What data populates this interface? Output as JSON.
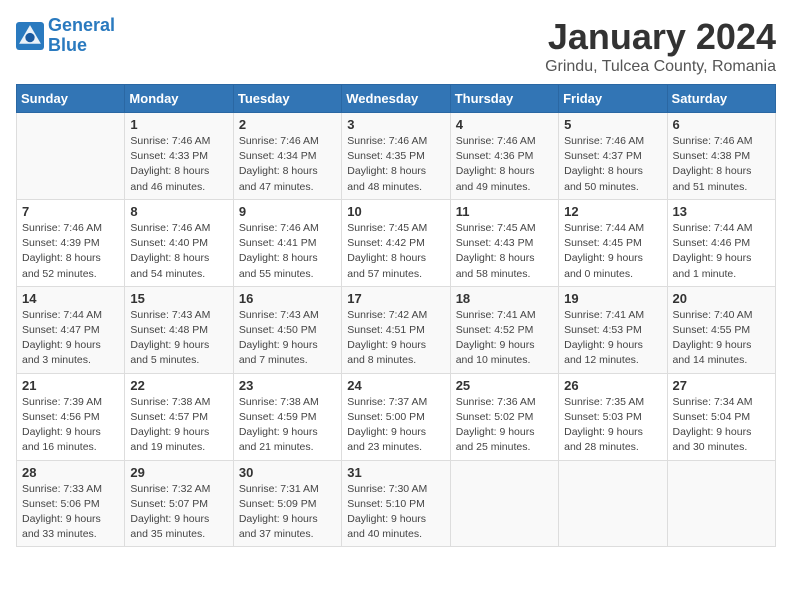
{
  "logo": {
    "line1": "General",
    "line2": "Blue"
  },
  "title": "January 2024",
  "location": "Grindu, Tulcea County, Romania",
  "weekdays": [
    "Sunday",
    "Monday",
    "Tuesday",
    "Wednesday",
    "Thursday",
    "Friday",
    "Saturday"
  ],
  "weeks": [
    [
      {
        "day": "",
        "sunrise": "",
        "sunset": "",
        "daylight": ""
      },
      {
        "day": "1",
        "sunrise": "Sunrise: 7:46 AM",
        "sunset": "Sunset: 4:33 PM",
        "daylight": "Daylight: 8 hours and 46 minutes."
      },
      {
        "day": "2",
        "sunrise": "Sunrise: 7:46 AM",
        "sunset": "Sunset: 4:34 PM",
        "daylight": "Daylight: 8 hours and 47 minutes."
      },
      {
        "day": "3",
        "sunrise": "Sunrise: 7:46 AM",
        "sunset": "Sunset: 4:35 PM",
        "daylight": "Daylight: 8 hours and 48 minutes."
      },
      {
        "day": "4",
        "sunrise": "Sunrise: 7:46 AM",
        "sunset": "Sunset: 4:36 PM",
        "daylight": "Daylight: 8 hours and 49 minutes."
      },
      {
        "day": "5",
        "sunrise": "Sunrise: 7:46 AM",
        "sunset": "Sunset: 4:37 PM",
        "daylight": "Daylight: 8 hours and 50 minutes."
      },
      {
        "day": "6",
        "sunrise": "Sunrise: 7:46 AM",
        "sunset": "Sunset: 4:38 PM",
        "daylight": "Daylight: 8 hours and 51 minutes."
      }
    ],
    [
      {
        "day": "7",
        "sunrise": "Sunrise: 7:46 AM",
        "sunset": "Sunset: 4:39 PM",
        "daylight": "Daylight: 8 hours and 52 minutes."
      },
      {
        "day": "8",
        "sunrise": "Sunrise: 7:46 AM",
        "sunset": "Sunset: 4:40 PM",
        "daylight": "Daylight: 8 hours and 54 minutes."
      },
      {
        "day": "9",
        "sunrise": "Sunrise: 7:46 AM",
        "sunset": "Sunset: 4:41 PM",
        "daylight": "Daylight: 8 hours and 55 minutes."
      },
      {
        "day": "10",
        "sunrise": "Sunrise: 7:45 AM",
        "sunset": "Sunset: 4:42 PM",
        "daylight": "Daylight: 8 hours and 57 minutes."
      },
      {
        "day": "11",
        "sunrise": "Sunrise: 7:45 AM",
        "sunset": "Sunset: 4:43 PM",
        "daylight": "Daylight: 8 hours and 58 minutes."
      },
      {
        "day": "12",
        "sunrise": "Sunrise: 7:44 AM",
        "sunset": "Sunset: 4:45 PM",
        "daylight": "Daylight: 9 hours and 0 minutes."
      },
      {
        "day": "13",
        "sunrise": "Sunrise: 7:44 AM",
        "sunset": "Sunset: 4:46 PM",
        "daylight": "Daylight: 9 hours and 1 minute."
      }
    ],
    [
      {
        "day": "14",
        "sunrise": "Sunrise: 7:44 AM",
        "sunset": "Sunset: 4:47 PM",
        "daylight": "Daylight: 9 hours and 3 minutes."
      },
      {
        "day": "15",
        "sunrise": "Sunrise: 7:43 AM",
        "sunset": "Sunset: 4:48 PM",
        "daylight": "Daylight: 9 hours and 5 minutes."
      },
      {
        "day": "16",
        "sunrise": "Sunrise: 7:43 AM",
        "sunset": "Sunset: 4:50 PM",
        "daylight": "Daylight: 9 hours and 7 minutes."
      },
      {
        "day": "17",
        "sunrise": "Sunrise: 7:42 AM",
        "sunset": "Sunset: 4:51 PM",
        "daylight": "Daylight: 9 hours and 8 minutes."
      },
      {
        "day": "18",
        "sunrise": "Sunrise: 7:41 AM",
        "sunset": "Sunset: 4:52 PM",
        "daylight": "Daylight: 9 hours and 10 minutes."
      },
      {
        "day": "19",
        "sunrise": "Sunrise: 7:41 AM",
        "sunset": "Sunset: 4:53 PM",
        "daylight": "Daylight: 9 hours and 12 minutes."
      },
      {
        "day": "20",
        "sunrise": "Sunrise: 7:40 AM",
        "sunset": "Sunset: 4:55 PM",
        "daylight": "Daylight: 9 hours and 14 minutes."
      }
    ],
    [
      {
        "day": "21",
        "sunrise": "Sunrise: 7:39 AM",
        "sunset": "Sunset: 4:56 PM",
        "daylight": "Daylight: 9 hours and 16 minutes."
      },
      {
        "day": "22",
        "sunrise": "Sunrise: 7:38 AM",
        "sunset": "Sunset: 4:57 PM",
        "daylight": "Daylight: 9 hours and 19 minutes."
      },
      {
        "day": "23",
        "sunrise": "Sunrise: 7:38 AM",
        "sunset": "Sunset: 4:59 PM",
        "daylight": "Daylight: 9 hours and 21 minutes."
      },
      {
        "day": "24",
        "sunrise": "Sunrise: 7:37 AM",
        "sunset": "Sunset: 5:00 PM",
        "daylight": "Daylight: 9 hours and 23 minutes."
      },
      {
        "day": "25",
        "sunrise": "Sunrise: 7:36 AM",
        "sunset": "Sunset: 5:02 PM",
        "daylight": "Daylight: 9 hours and 25 minutes."
      },
      {
        "day": "26",
        "sunrise": "Sunrise: 7:35 AM",
        "sunset": "Sunset: 5:03 PM",
        "daylight": "Daylight: 9 hours and 28 minutes."
      },
      {
        "day": "27",
        "sunrise": "Sunrise: 7:34 AM",
        "sunset": "Sunset: 5:04 PM",
        "daylight": "Daylight: 9 hours and 30 minutes."
      }
    ],
    [
      {
        "day": "28",
        "sunrise": "Sunrise: 7:33 AM",
        "sunset": "Sunset: 5:06 PM",
        "daylight": "Daylight: 9 hours and 33 minutes."
      },
      {
        "day": "29",
        "sunrise": "Sunrise: 7:32 AM",
        "sunset": "Sunset: 5:07 PM",
        "daylight": "Daylight: 9 hours and 35 minutes."
      },
      {
        "day": "30",
        "sunrise": "Sunrise: 7:31 AM",
        "sunset": "Sunset: 5:09 PM",
        "daylight": "Daylight: 9 hours and 37 minutes."
      },
      {
        "day": "31",
        "sunrise": "Sunrise: 7:30 AM",
        "sunset": "Sunset: 5:10 PM",
        "daylight": "Daylight: 9 hours and 40 minutes."
      },
      {
        "day": "",
        "sunrise": "",
        "sunset": "",
        "daylight": ""
      },
      {
        "day": "",
        "sunrise": "",
        "sunset": "",
        "daylight": ""
      },
      {
        "day": "",
        "sunrise": "",
        "sunset": "",
        "daylight": ""
      }
    ]
  ]
}
